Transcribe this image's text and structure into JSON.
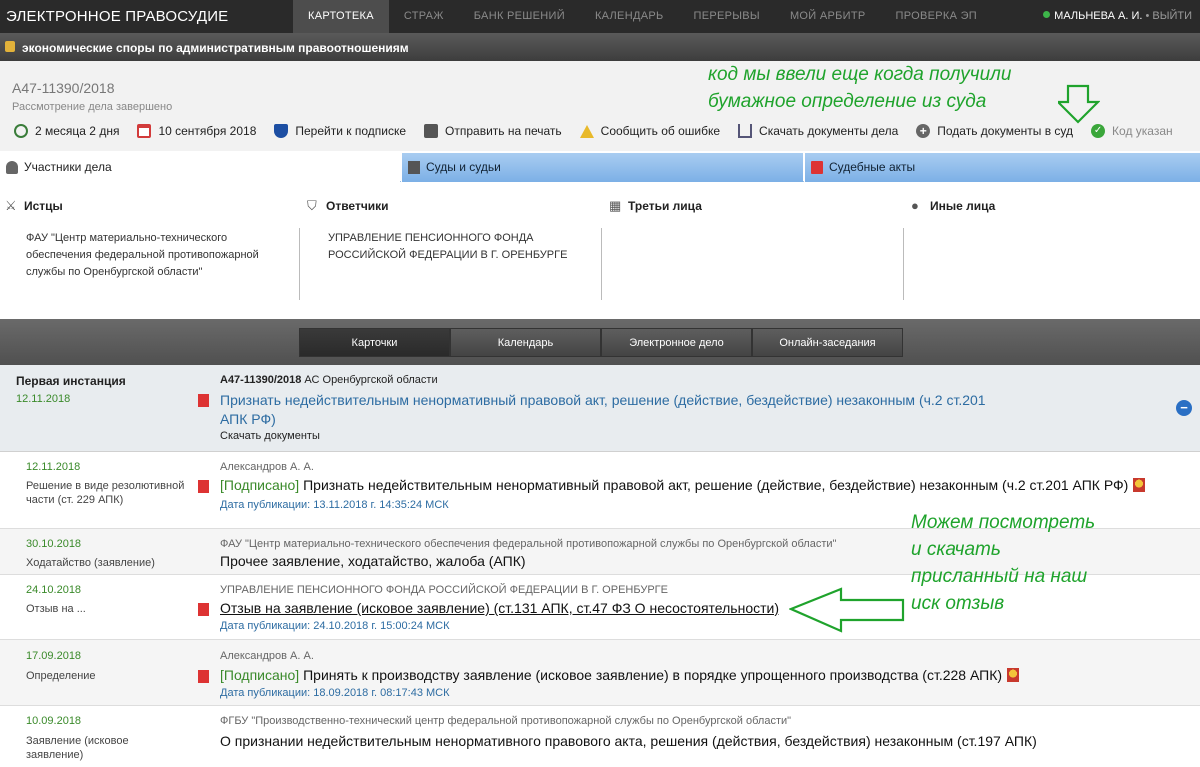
{
  "brand": "ЭЛЕКТРОННОЕ ПРАВОСУДИЕ",
  "nav": [
    "КАРТОТЕКА",
    "СТРАЖ",
    "БАНК РЕШЕНИЙ",
    "КАЛЕНДАРЬ",
    "ПЕРЕРЫВЫ",
    "МОЙ АРБИТР",
    "ПРОВЕРКА ЭП"
  ],
  "user": {
    "name": "МАЛЬНЕВА А. И.",
    "sep": " • ",
    "logout": "ВЫЙТИ",
    "status_color": "#3db54a"
  },
  "category": "экономические споры по административным правоотношениям",
  "case": {
    "number": "А47-11390/2018",
    "status": "Рассмотрение дела завершено"
  },
  "tools": {
    "duration": "2 месяца 2 дня",
    "date": "10 сентября 2018",
    "subscribe": "Перейти к подписке",
    "print": "Отправить на печать",
    "report": "Сообщить об ошибке",
    "download": "Скачать документы дела",
    "submit": "Подать документы в суд",
    "code": "Код указан"
  },
  "tabs": {
    "participants": "Участники дела",
    "courts": "Суды и судьи",
    "acts": "Судебные акты"
  },
  "parties": {
    "plaintiffs": {
      "title": "Истцы",
      "body": "ФАУ \"Центр материально-технического обеспечения федеральной противопожарной службы по Оренбургской области\""
    },
    "defendants": {
      "title": "Ответчики",
      "body": "УПРАВЛЕНИЕ ПЕНСИОННОГО ФОНДА РОССИЙСКОЙ ФЕДЕРАЦИИ В Г. ОРЕНБУРГЕ"
    },
    "third": {
      "title": "Третьи лица",
      "body": ""
    },
    "other": {
      "title": "Иные лица",
      "body": ""
    }
  },
  "subnav": [
    "Карточки",
    "Календарь",
    "Электронное дело",
    "Онлайн-заседания"
  ],
  "instance": {
    "label": "Первая инстанция",
    "date": "12.11.2018",
    "case_no": "А47-11390/2018",
    "court": " АС Оренбургской области",
    "desc": "Признать недействительным ненормативный правовой акт, решение (действие, бездействие) незаконным (ч.2 ст.201 АПК РФ)",
    "download": "Скачать документы"
  },
  "events": [
    {
      "date": "12.11.2018",
      "type": "Решение в виде резолютивной части (ст. 229 АПК)",
      "who": "Александров А. А.",
      "signed": "[Подписано]",
      "main": " Признать недействительным ненормативный правовой акт, решение (действие, бездействие) незаконным (ч.2 ст.201 АПК РФ)",
      "pub": "Дата публикации: 13.11.2018 г. 14:35:24 МСК"
    },
    {
      "date": "30.10.2018",
      "type": "Ходатайство (заявление)",
      "who": "ФАУ \"Центр материально-технического обеспечения федеральной противопожарной службы по Оренбургской области\"",
      "main": "Прочее заявление, ходатайство, жалоба (АПК)"
    },
    {
      "date": "24.10.2018",
      "type": "Отзыв на ...",
      "who": "УПРАВЛЕНИЕ ПЕНСИОННОГО ФОНДА РОССИЙСКОЙ ФЕДЕРАЦИИ В Г. ОРЕНБУРГЕ",
      "main": "Отзыв на заявление (исковое заявление) (ст.131 АПК, ст.47 ФЗ О несостоятельности)",
      "pub": "Дата публикации: 24.10.2018 г. 15:00:24 МСК"
    },
    {
      "date": "17.09.2018",
      "type": "Определение",
      "who": "Александров А. А.",
      "signed": "[Подписано]",
      "main": " Принять к производству заявление (исковое заявление) в порядке упрощенного производства (ст.228 АПК)",
      "pub": "Дата публикации: 18.09.2018 г. 08:17:43 МСК"
    },
    {
      "date": "10.09.2018",
      "type": "Заявление (исковое заявление)",
      "who": "ФГБУ \"Производственно-технический центр федеральной противопожарной службы по Оренбургской области\"",
      "main": "О признании недействительным ненормативного правового акта, решения (действия, бездействия) незаконным (ст.197 АПК)"
    }
  ],
  "annotations": {
    "code_note": "код мы ввели еще когда получили бумажное определение из суда",
    "review_note": "Можем посмотреть и скачать присланный на наш иск отзыв",
    "color": "#1fa32c"
  }
}
